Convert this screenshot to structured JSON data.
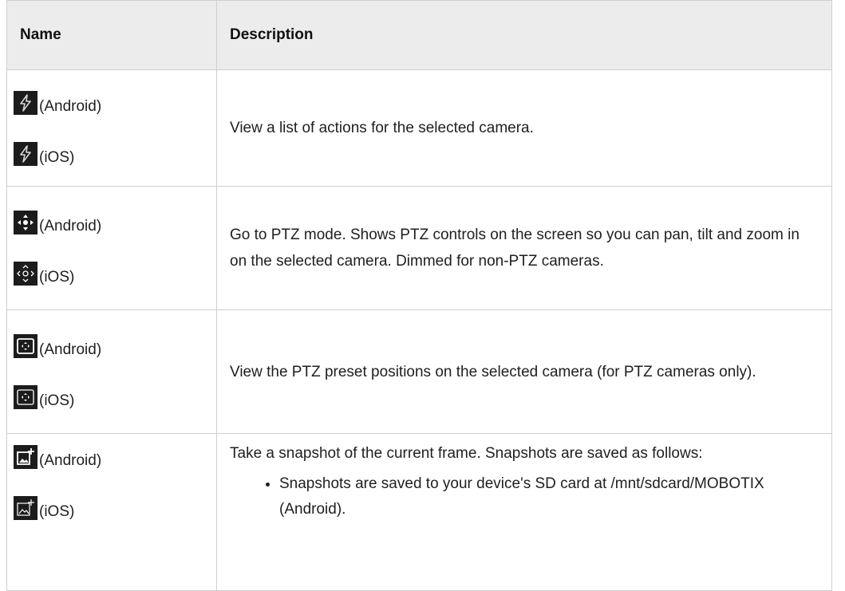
{
  "table": {
    "headers": {
      "name": "Name",
      "description": "Description"
    },
    "rows": [
      {
        "android_label": "(Android)",
        "ios_label": "(iOS)",
        "android_icon": "actions-bolt-icon",
        "ios_icon": "actions-bolt-icon",
        "description": "View a list of actions for the selected camera."
      },
      {
        "android_label": "(Android)",
        "ios_label": "(iOS)",
        "android_icon": "ptz-move-icon",
        "ios_icon": "ptz-move-icon",
        "description": "Go to PTZ mode. Shows PTZ controls on the screen so you can pan, tilt and zoom in on the selected camera. Dimmed for non-PTZ cameras."
      },
      {
        "android_label": "(Android)",
        "ios_label": "(iOS)",
        "android_icon": "ptz-preset-icon",
        "ios_icon": "ptz-preset-icon",
        "description": "View the PTZ preset positions on the selected camera (for PTZ cameras only)."
      },
      {
        "android_label": "(Android)",
        "ios_label": "(iOS)",
        "android_icon": "snapshot-add-icon",
        "ios_icon": "snapshot-add-icon",
        "description": "Take a snapshot of the current frame. Snapshots are saved as follows:",
        "bullets": [
          "Snapshots are saved to your device's SD card at /mnt/sdcard/MOBOTIX (Android)."
        ]
      }
    ]
  }
}
